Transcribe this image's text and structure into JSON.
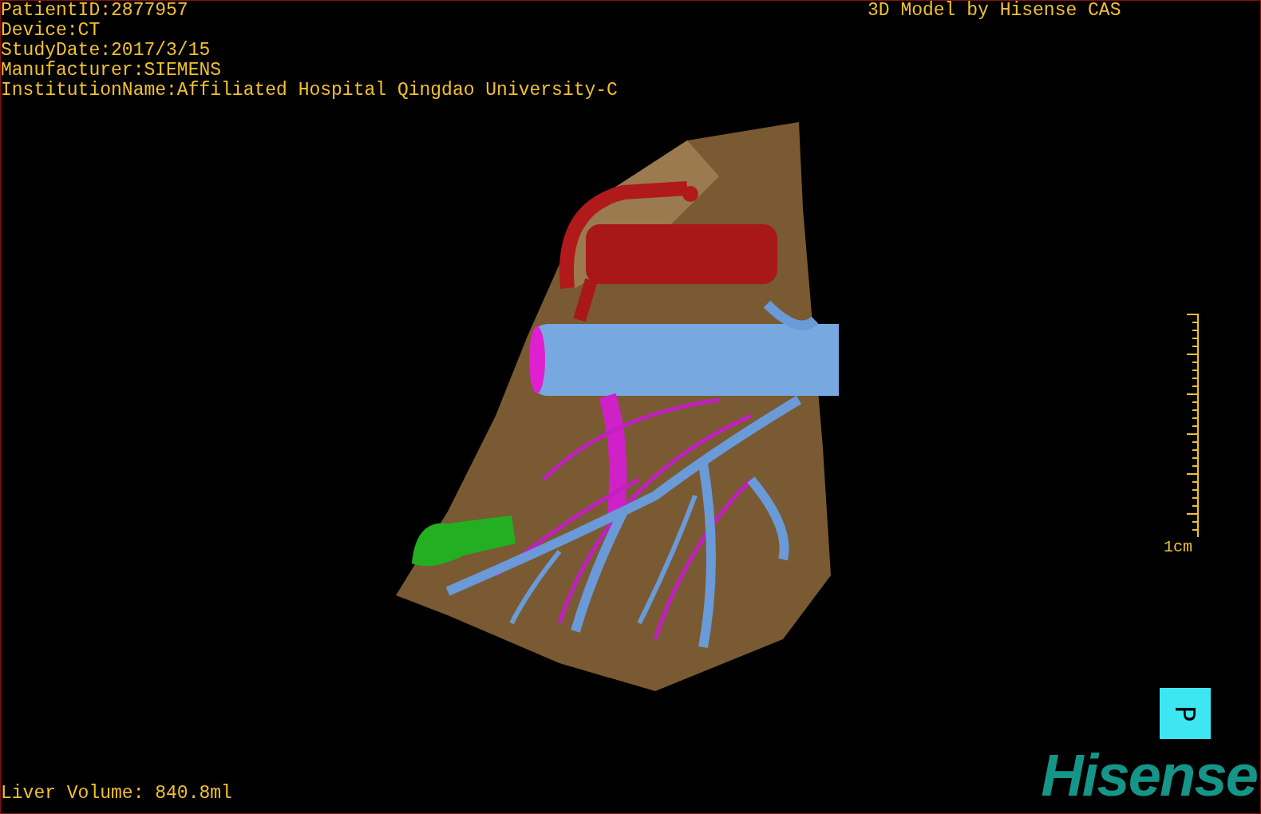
{
  "info_lines": [
    "PatientID:2877957",
    "Device:CT",
    "StudyDate:2017/3/15",
    "Manufacturer:SIEMENS",
    "InstitutionName:Affiliated Hospital Qingdao University-C"
  ],
  "title": "3D Model by Hisense CAS",
  "scale": {
    "label": "1cm"
  },
  "orientation": {
    "label": "P"
  },
  "volume": "Liver Volume: 840.8ml",
  "logo": "Hisense"
}
